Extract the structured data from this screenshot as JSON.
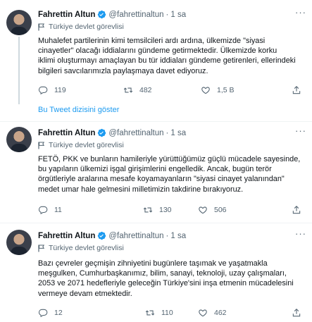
{
  "show_thread": "Bu Tweet dizisini göster",
  "colors": {
    "accent": "#1d9bf0",
    "muted": "#536471",
    "text": "#0f1419"
  },
  "tweets": [
    {
      "name": "Fahrettin Altun",
      "handle": "@fahrettinaltun",
      "dot": "·",
      "time": "1 sa",
      "more": "···",
      "label": "Türkiye devlet görevlisi",
      "lines": [
        "Muhalefet partilerinin kimi temsilcileri ardı ardına, ülkemizde \"siyasi",
        "cinayetler\" olacağı iddialarını gündeme getirmektedir. Ülkemizde korku",
        "iklimi oluşturmayı amaçlayan bu tür iddiaları gündeme getirenleri, ellerindeki",
        "bilgileri savcılarımızla paylaşmaya davet ediyoruz."
      ],
      "replies": "119",
      "retweets": "482",
      "likes": "1,5 B"
    },
    {
      "name": "Fahrettin Altun",
      "handle": "@fahrettinaltun",
      "dot": "·",
      "time": "1 sa",
      "more": "···",
      "label": "Türkiye devlet görevlisi",
      "lines": [
        "FETÖ, PKK ve bunların hamileriyle yürüttüğümüz güçlü mücadele sayesinde,",
        "bu yapıların ülkemizi işgal girişimlerini engelledik. Ancak, bugün terör",
        "örgütleriyle aralarına mesafe koyamayanların \"siyasi cinayet yalanından\"",
        "medet umar hale gelmesini milletimizin takdirine bırakıyoruz."
      ],
      "replies": "11",
      "retweets": "130",
      "likes": "506"
    },
    {
      "name": "Fahrettin Altun",
      "handle": "@fahrettinaltun",
      "dot": "·",
      "time": "1 sa",
      "more": "···",
      "label": "Türkiye devlet görevlisi",
      "lines": [
        "Bazı çevreler geçmişin zihniyetini bugünlere taşımak ve yaşatmakla",
        "meşgulken, Cumhurbaşkanımız, bilim, sanayi, teknoloji, uzay çalışmaları,",
        "2053 ve 2071 hedefleriyle geleceğin Türkiye'sini inşa etmenin mücadelesini",
        "vermeye devam etmektedir."
      ],
      "replies": "12",
      "retweets": "110",
      "likes": "462"
    }
  ]
}
